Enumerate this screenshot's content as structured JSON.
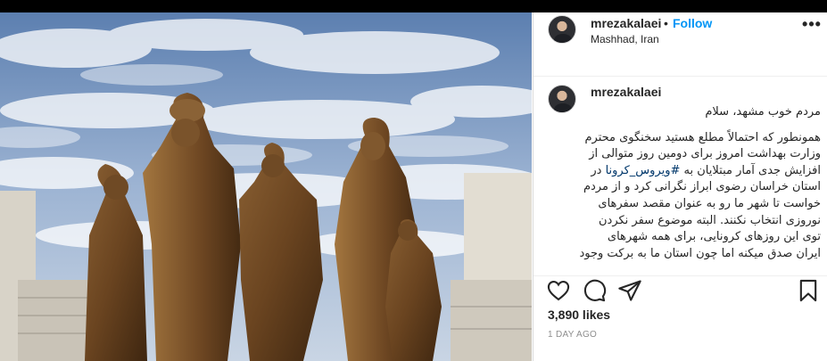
{
  "post": {
    "author": {
      "username": "mrezakalaei",
      "dot": "•",
      "follow_label": "Follow",
      "location": "Mashhad, Iran"
    },
    "more_icon": "more-horizontal-icon",
    "caption": {
      "username": "mrezakalaei",
      "greeting": "مردم خوب مشهد، سلام",
      "line_1": "همونطور که احتمالاً مطلع هستید سخنگوی محترم",
      "line_2": "وزارت بهداشت امروز برای دومین روز متوالی از",
      "line_3_start": "افزایش جدی آمار مبتلایان به ",
      "hashtag": "#ویروس_کرونا",
      "line_3_end": " در",
      "line_4": "استان خراسان رضوی ابراز نگرانی کرد و از مردم",
      "line_5": "خواست تا شهر ما رو به عنوان مقصد سفرهای",
      "line_6": "نوروزی انتخاب نکنند. البته موضوع سفر نکردن",
      "line_7": "توی این روزهای کرونایی، برای همه شهرهای",
      "line_8": "ایران صدق میکنه اما چون استان ما به برکت وجود"
    },
    "actions": {
      "like_icon": "heart-icon",
      "comment_icon": "comment-icon",
      "share_icon": "share-icon",
      "save_icon": "bookmark-icon"
    },
    "likes": "3,890 likes",
    "time_ago": "1 DAY AGO"
  },
  "colors": {
    "follow": "#0095f6",
    "hashtag": "#00376b",
    "muted": "#8e8e8e",
    "border": "#dbdbdb"
  }
}
